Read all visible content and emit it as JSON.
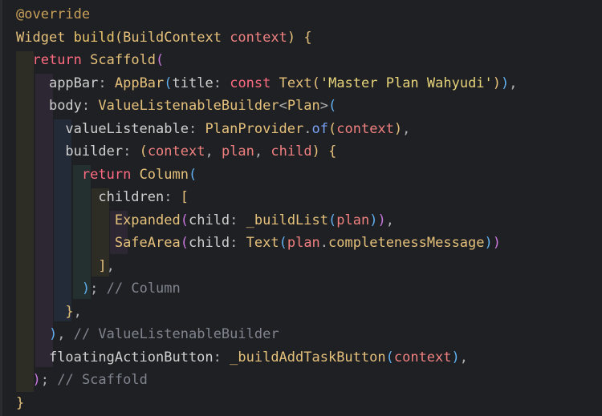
{
  "editor": {
    "lines": [
      [
        {
          "t": "@override",
          "c": "ann"
        }
      ],
      [
        {
          "t": "Widget",
          "c": "type"
        },
        {
          "t": " ",
          "c": ""
        },
        {
          "t": "build",
          "c": "fn"
        },
        {
          "t": "(",
          "c": "brace2"
        },
        {
          "t": "BuildContext",
          "c": "type"
        },
        {
          "t": " ",
          "c": ""
        },
        {
          "t": "context",
          "c": "param"
        },
        {
          "t": ")",
          "c": "brace2"
        },
        {
          "t": " ",
          "c": ""
        },
        {
          "t": "{",
          "c": "brace2"
        }
      ],
      [
        {
          "t": "  ",
          "c": ""
        },
        {
          "t": "return",
          "c": "kw"
        },
        {
          "t": " ",
          "c": ""
        },
        {
          "t": "Scaffold",
          "c": "type"
        },
        {
          "t": "(",
          "c": "brace1"
        }
      ],
      [
        {
          "t": "    ",
          "c": ""
        },
        {
          "t": "appBar",
          "c": "prop"
        },
        {
          "t": ": ",
          "c": "punc"
        },
        {
          "t": "AppBar",
          "c": "type"
        },
        {
          "t": "(",
          "c": "brace3"
        },
        {
          "t": "title",
          "c": "prop"
        },
        {
          "t": ": ",
          "c": "punc"
        },
        {
          "t": "const",
          "c": "kw"
        },
        {
          "t": " ",
          "c": ""
        },
        {
          "t": "Text",
          "c": "type"
        },
        {
          "t": "(",
          "c": "brace2"
        },
        {
          "t": "'Master Plan Wahyudi'",
          "c": "str"
        },
        {
          "t": ")",
          "c": "brace2"
        },
        {
          "t": ")",
          "c": "brace3"
        },
        {
          "t": ",",
          "c": "punc"
        }
      ],
      [
        {
          "t": "    ",
          "c": ""
        },
        {
          "t": "body",
          "c": "prop"
        },
        {
          "t": ": ",
          "c": "punc"
        },
        {
          "t": "ValueListenableBuilder",
          "c": "type"
        },
        {
          "t": "<",
          "c": "punc"
        },
        {
          "t": "Plan",
          "c": "type"
        },
        {
          "t": ">",
          "c": "punc"
        },
        {
          "t": "(",
          "c": "brace3"
        }
      ],
      [
        {
          "t": "      ",
          "c": ""
        },
        {
          "t": "valueListenable",
          "c": "prop"
        },
        {
          "t": ": ",
          "c": "punc"
        },
        {
          "t": "PlanProvider",
          "c": "type"
        },
        {
          "t": ".",
          "c": "punc"
        },
        {
          "t": "of",
          "c": "call"
        },
        {
          "t": "(",
          "c": "brace2"
        },
        {
          "t": "context",
          "c": "param"
        },
        {
          "t": ")",
          "c": "brace2"
        },
        {
          "t": ",",
          "c": "punc"
        }
      ],
      [
        {
          "t": "      ",
          "c": ""
        },
        {
          "t": "builder",
          "c": "prop"
        },
        {
          "t": ": ",
          "c": "punc"
        },
        {
          "t": "(",
          "c": "brace2"
        },
        {
          "t": "context",
          "c": "param"
        },
        {
          "t": ", ",
          "c": "punc"
        },
        {
          "t": "plan",
          "c": "param"
        },
        {
          "t": ", ",
          "c": "punc"
        },
        {
          "t": "child",
          "c": "param"
        },
        {
          "t": ")",
          "c": "brace2"
        },
        {
          "t": " ",
          "c": ""
        },
        {
          "t": "{",
          "c": "brace2"
        }
      ],
      [
        {
          "t": "        ",
          "c": ""
        },
        {
          "t": "return",
          "c": "kw"
        },
        {
          "t": " ",
          "c": ""
        },
        {
          "t": "Column",
          "c": "type"
        },
        {
          "t": "(",
          "c": "brace3"
        }
      ],
      [
        {
          "t": "          ",
          "c": ""
        },
        {
          "t": "children",
          "c": "prop"
        },
        {
          "t": ": ",
          "c": "punc"
        },
        {
          "t": "[",
          "c": "brace2"
        }
      ],
      [
        {
          "t": "            ",
          "c": ""
        },
        {
          "t": "Expanded",
          "c": "type"
        },
        {
          "t": "(",
          "c": "brace1"
        },
        {
          "t": "child",
          "c": "prop"
        },
        {
          "t": ": ",
          "c": "punc"
        },
        {
          "t": "_buildList",
          "c": "method"
        },
        {
          "t": "(",
          "c": "brace3"
        },
        {
          "t": "plan",
          "c": "param"
        },
        {
          "t": ")",
          "c": "brace3"
        },
        {
          "t": ")",
          "c": "brace1"
        },
        {
          "t": ",",
          "c": "punc"
        }
      ],
      [
        {
          "t": "            ",
          "c": ""
        },
        {
          "t": "SafeArea",
          "c": "type"
        },
        {
          "t": "(",
          "c": "brace1"
        },
        {
          "t": "child",
          "c": "prop"
        },
        {
          "t": ": ",
          "c": "punc"
        },
        {
          "t": "Text",
          "c": "type"
        },
        {
          "t": "(",
          "c": "brace3"
        },
        {
          "t": "plan",
          "c": "param"
        },
        {
          "t": ".",
          "c": "punc"
        },
        {
          "t": "completenessMessage",
          "c": "method"
        },
        {
          "t": ")",
          "c": "brace3"
        },
        {
          "t": ")",
          "c": "brace1"
        }
      ],
      [
        {
          "t": "          ",
          "c": ""
        },
        {
          "t": "]",
          "c": "brace2"
        },
        {
          "t": ",",
          "c": "punc"
        }
      ],
      [
        {
          "t": "        ",
          "c": ""
        },
        {
          "t": ")",
          "c": "brace3"
        },
        {
          "t": ";",
          "c": "punc"
        },
        {
          "t": " ",
          "c": ""
        },
        {
          "t": "// Column",
          "c": "comment"
        }
      ],
      [
        {
          "t": "      ",
          "c": ""
        },
        {
          "t": "}",
          "c": "brace2"
        },
        {
          "t": ",",
          "c": "punc"
        }
      ],
      [
        {
          "t": "    ",
          "c": ""
        },
        {
          "t": ")",
          "c": "brace3"
        },
        {
          "t": ",",
          "c": "punc"
        },
        {
          "t": " ",
          "c": ""
        },
        {
          "t": "// ValueListenableBuilder",
          "c": "comment"
        }
      ],
      [
        {
          "t": "    ",
          "c": ""
        },
        {
          "t": "floatingActionButton",
          "c": "prop"
        },
        {
          "t": ": ",
          "c": "punc"
        },
        {
          "t": "_buildAddTaskButton",
          "c": "method"
        },
        {
          "t": "(",
          "c": "brace3"
        },
        {
          "t": "context",
          "c": "param"
        },
        {
          "t": ")",
          "c": "brace3"
        },
        {
          "t": ",",
          "c": "punc"
        }
      ],
      [
        {
          "t": "  ",
          "c": ""
        },
        {
          "t": ")",
          "c": "brace1"
        },
        {
          "t": ";",
          "c": "punc"
        },
        {
          "t": " ",
          "c": ""
        },
        {
          "t": "// Scaffold",
          "c": "comment"
        }
      ],
      [
        {
          "t": "}",
          "c": "brace2"
        }
      ]
    ]
  }
}
